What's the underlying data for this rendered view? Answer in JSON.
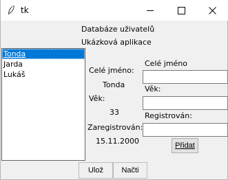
{
  "window": {
    "title": "tk"
  },
  "header": {
    "line1": "Databáze uživatelů",
    "line2": "Ukázková aplikace"
  },
  "users": {
    "items": [
      {
        "label": "Tonda",
        "selected": true
      },
      {
        "label": "Jarda",
        "selected": false
      },
      {
        "label": "Lukáš",
        "selected": false
      }
    ]
  },
  "detail": {
    "name_label": "Celé jméno:",
    "name_value": "Tonda",
    "age_label": "Věk:",
    "age_value": "33",
    "registered_label": "Zaregistrován:",
    "registered_value": "15.11.2000"
  },
  "form": {
    "name_label": "Celé jméno",
    "name_value": "",
    "age_label": "Věk:",
    "age_value": "",
    "registered_label": "Registrován:",
    "registered_value": "",
    "add_button_label": "Přidat"
  },
  "footer": {
    "save_button_label": "Ulož",
    "load_button_label": "Načti"
  }
}
